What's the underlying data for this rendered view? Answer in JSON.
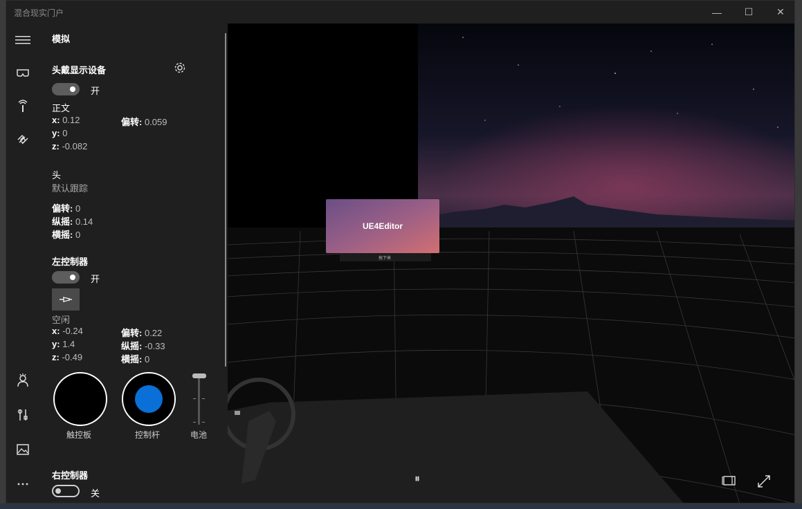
{
  "window": {
    "title": "混合现实门户",
    "min": "—",
    "max": "☐",
    "close": "✕"
  },
  "panel": {
    "section_title": "模拟",
    "hmd": {
      "title": "头戴显示设备",
      "toggle_state": "开",
      "pose_title": "正文",
      "x_label": "x:",
      "x_value": "0.12",
      "y_label": "y:",
      "y_value": "0",
      "z_label": "z:",
      "z_value": "-0.082",
      "yaw_label": "偏转:",
      "yaw_value": "0.059"
    },
    "head": {
      "title": "头",
      "mode": "默认跟踪",
      "yaw_label": "偏转:",
      "yaw_value": "0",
      "pitch_label": "纵摇:",
      "pitch_value": "0.14",
      "roll_label": "横摇:",
      "roll_value": "0"
    },
    "left_controller": {
      "title": "左控制器",
      "toggle_state": "开",
      "status": "空闲",
      "x_label": "x:",
      "x_value": "-0.24",
      "y_label": "y:",
      "y_value": "1.4",
      "z_label": "z:",
      "z_value": "-0.49",
      "yaw_label": "偏转:",
      "yaw_value": "0.22",
      "pitch_label": "纵摇:",
      "pitch_value": "-0.33",
      "roll_label": "横摇:",
      "roll_value": "0",
      "touchpad_label": "触控板",
      "thumbstick_label": "控制杆",
      "battery_label": "电池"
    },
    "right_controller": {
      "title": "右控制器",
      "toggle_state": "关"
    }
  },
  "viewport": {
    "app_window_title": "UE4Editor",
    "app_window_caption": "拖下来",
    "pause_icon": "⏸",
    "accent": "#0a6fd6"
  },
  "icons": [
    "hamburger-icon",
    "headset-icon",
    "controller-icon",
    "hands-icon",
    "avatar-icon",
    "tools-icon",
    "image-icon",
    "more-icon",
    "gear-icon",
    "pin-icon",
    "split-view-icon",
    "expand-icon"
  ]
}
